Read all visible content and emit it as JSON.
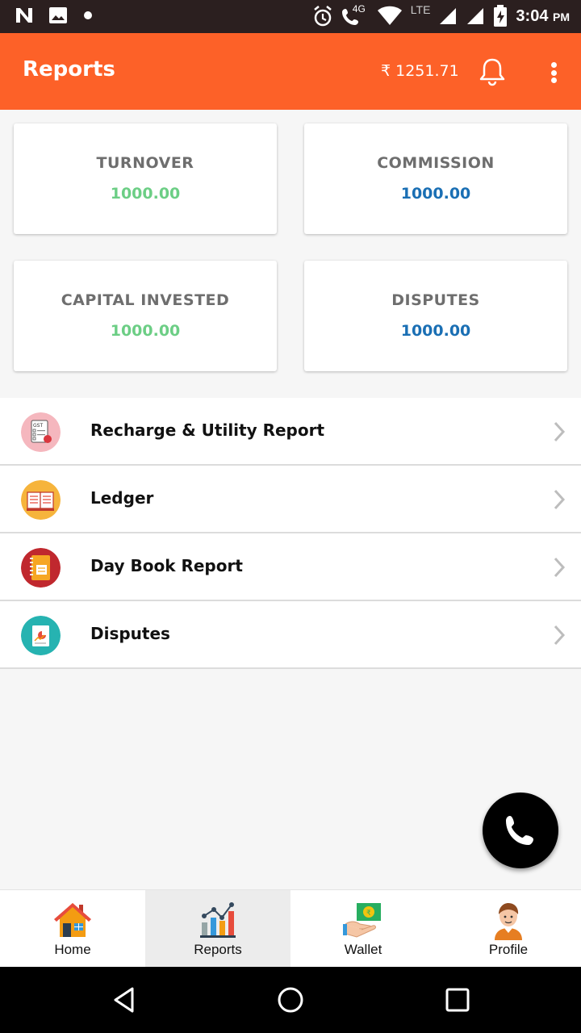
{
  "status_bar": {
    "network_label": "4G",
    "lte_label": "LTE",
    "time": "3:04",
    "ampm": "PM"
  },
  "app_bar": {
    "title": "Reports",
    "balance": "₹ 1251.71",
    "icons": [
      "bell-icon",
      "more-vert-icon"
    ]
  },
  "stats": [
    {
      "label": "TURNOVER",
      "value": "1000.00",
      "color": "#6cce85"
    },
    {
      "label": "COMMISSION",
      "value": "1000.00",
      "color": "#1a6fb4"
    },
    {
      "label": "CAPITAL INVESTED",
      "value": "1000.00",
      "color": "#6cce85"
    },
    {
      "label": "DISPUTES",
      "value": "1000.00",
      "color": "#1a6fb4"
    }
  ],
  "menu": {
    "items": [
      {
        "label": "Recharge & Utility Report",
        "icon": "gst-report-icon"
      },
      {
        "label": "Ledger",
        "icon": "book-icon"
      },
      {
        "label": "Day Book Report",
        "icon": "notebook-icon"
      },
      {
        "label": "Disputes",
        "icon": "document-chart-icon"
      }
    ]
  },
  "fab": {
    "icon": "phone-icon"
  },
  "bottom_nav": {
    "items": [
      {
        "label": "Home",
        "icon": "home-icon"
      },
      {
        "label": "Reports",
        "icon": "reports-icon",
        "active": true
      },
      {
        "label": "Wallet",
        "icon": "wallet-icon"
      },
      {
        "label": "Profile",
        "icon": "profile-icon"
      }
    ]
  },
  "colors": {
    "accent": "#fd6128",
    "status_bar": "#2b1f1f"
  }
}
